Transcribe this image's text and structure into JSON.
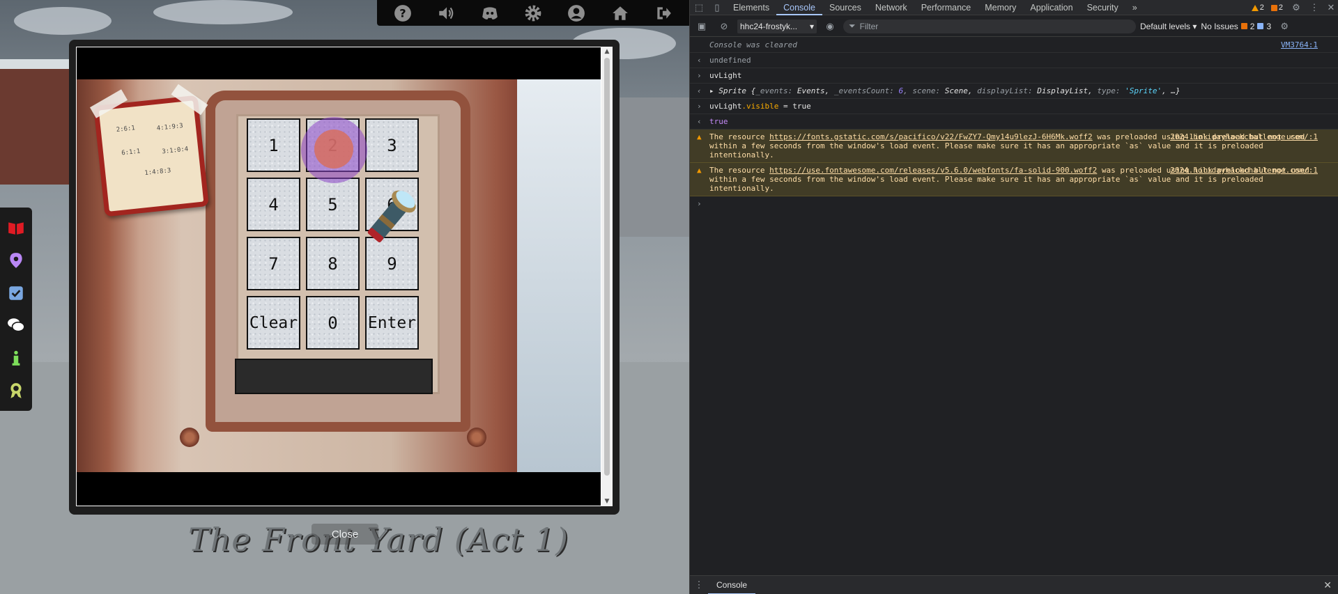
{
  "game": {
    "location_title": "The Front Yard (Act 1)",
    "topbar_icons": [
      "help-icon",
      "volume-icon",
      "discord-icon",
      "settings-gear-icon",
      "user-account-icon",
      "home-icon",
      "logout-icon"
    ],
    "sidebar_icons": [
      "book-icon",
      "map-pin-icon",
      "checklist-icon",
      "chat-icon",
      "info-icon",
      "badge-icon"
    ],
    "sidebar_colors": [
      "#e01b24",
      "#b987f5",
      "#7aa7e0",
      "#ffffff",
      "#7dde5a",
      "#c8d66a"
    ],
    "modal": {
      "close_label": "Close",
      "note_lines": [
        "2:6:1",
        "4:1:9:3",
        "6:1:1",
        "3:1:0:4",
        "1:4:8:3"
      ],
      "keypad": {
        "keys": [
          "1",
          "2",
          "3",
          "4",
          "5",
          "6",
          "7",
          "8",
          "9",
          "Clear",
          "0",
          "Enter"
        ]
      },
      "display_value": ""
    }
  },
  "devtools": {
    "tabs": [
      "Elements",
      "Console",
      "Sources",
      "Network",
      "Performance",
      "Memory",
      "Application",
      "Security"
    ],
    "active_tab": "Console",
    "overflow_label": "»",
    "warn_count": "2",
    "issue_count": "2",
    "toolbar": {
      "context": "hhc24-frostyk...",
      "filter_placeholder": "Filter",
      "levels": "Default levels",
      "no_issues": "No Issues",
      "issues_warn": "2",
      "issues_info": "3"
    },
    "console": {
      "cleared": "Console was cleared",
      "cleared_src": "VM3764:1",
      "out_undefined": "undefined",
      "in_uvlight": "uvLight",
      "sprite_prefix": "Sprite {",
      "sprite_k1": "_events:",
      "sprite_v1": " Events, ",
      "sprite_k2": "_eventsCount:",
      "sprite_v2": "6",
      "sprite_k3": ", scene:",
      "sprite_v3": " Scene, ",
      "sprite_k4": "displayList:",
      "sprite_v4": " DisplayList, ",
      "sprite_k5": "type:",
      "sprite_v5": "'Sprite'",
      "sprite_suffix": ", …}",
      "in_visible_obj": "uvLight",
      "in_visible_prop": ".visible",
      "in_visible_rest": " = true",
      "out_true": "true",
      "warn1_pre": "The resource ",
      "warn1_url": "https://fonts.gstatic.com/s/pacifico/v22/FwZY7-Qmy14u9lezJ-6H6Mk.woff2",
      "warn1_post": " was preloaded using link preload but not used within a few seconds from the window's load event. Please make sure it has an appropriate `as` value and it is preloaded intentionally.",
      "warn1_src": "2024.holidayhackchallenge.com/:1",
      "warn2_pre": "The resource ",
      "warn2_url": "https://use.fontawesome.com/releases/v5.6.0/webfonts/fa-solid-900.woff2",
      "warn2_post": " was preloaded using link preload but not used within a few seconds from the window's load event. Please make sure it has an appropriate `as` value and it is preloaded intentionally.",
      "warn2_src": "2024.holidayhackchallenge.com/:1"
    },
    "drawer_tab": "Console"
  }
}
